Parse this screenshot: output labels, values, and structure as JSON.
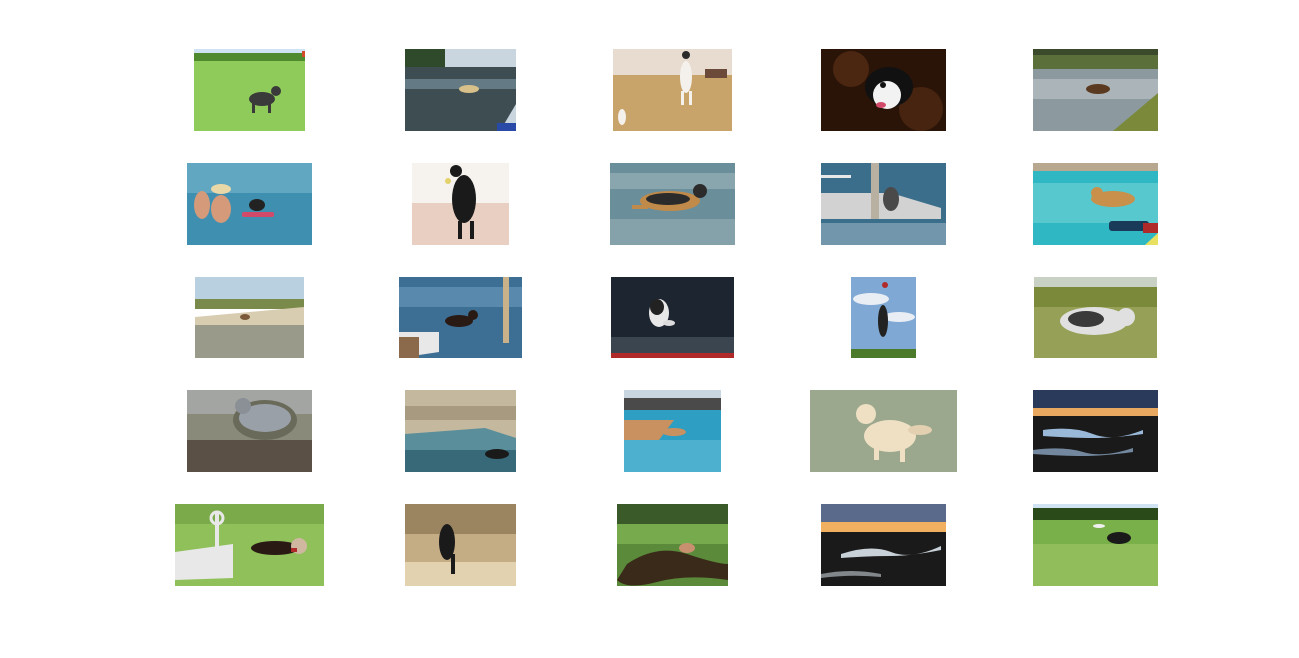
{
  "grid": {
    "rows": 5,
    "columns": 5
  },
  "thumbnails": [
    {
      "row": 1,
      "col": 1,
      "subject": "dog-running-on-grass",
      "palette": [
        "#8ecb5a",
        "#4f8a2e",
        "#3a3a3a",
        "#cfe3f2"
      ]
    },
    {
      "row": 1,
      "col": 2,
      "subject": "dog-swimming-near-dock",
      "palette": [
        "#3d4d52",
        "#7f9aa6",
        "#d8c08a",
        "#c9d6e0"
      ]
    },
    {
      "row": 1,
      "col": 3,
      "subject": "dogs-jumping-in-field",
      "palette": [
        "#c9a46a",
        "#e8dcd0",
        "#f4f1ec",
        "#6b4a3a"
      ]
    },
    {
      "row": 1,
      "col": 4,
      "subject": "dog-face-in-leaves",
      "palette": [
        "#2a1408",
        "#5a2e14",
        "#f2f2f2",
        "#111111"
      ]
    },
    {
      "row": 1,
      "col": 5,
      "subject": "dog-swimming-in-pond",
      "palette": [
        "#8c9aa0",
        "#5a6f3a",
        "#c9cfd2",
        "#5a3a20"
      ]
    },
    {
      "row": 2,
      "col": 1,
      "subject": "people-and-dog-in-sea",
      "palette": [
        "#3f8fb0",
        "#7ab8cf",
        "#d49a7a",
        "#d24a6a"
      ]
    },
    {
      "row": 2,
      "col": 2,
      "subject": "dog-catching-ball-silhouette",
      "palette": [
        "#f6f3ef",
        "#e8cfc2",
        "#1a1a1a",
        "#e3d26a"
      ]
    },
    {
      "row": 2,
      "col": 3,
      "subject": "shepherd-dog-leaping-in-water",
      "palette": [
        "#6a8e9a",
        "#9fb6bc",
        "#c08a4a",
        "#2b2b2b"
      ]
    },
    {
      "row": 2,
      "col": 4,
      "subject": "dog-jumping-off-pier",
      "palette": [
        "#3a6e8a",
        "#d2d2d2",
        "#4a4a4a",
        "#a9c0cf"
      ]
    },
    {
      "row": 2,
      "col": 5,
      "subject": "dog-diving-into-pool",
      "palette": [
        "#2fb8c4",
        "#7fd8d8",
        "#c8904a",
        "#b02a2a"
      ]
    },
    {
      "row": 3,
      "col": 1,
      "subject": "dog-on-sandbar",
      "palette": [
        "#b9d0e0",
        "#d8cdb0",
        "#7a8a4a",
        "#9a9a8a"
      ]
    },
    {
      "row": 3,
      "col": 2,
      "subject": "dog-leaping-from-boat",
      "palette": [
        "#3d6f95",
        "#6d9cbf",
        "#c9b28a",
        "#2a1a14"
      ]
    },
    {
      "row": 3,
      "col": 3,
      "subject": "dog-catching-frisbee-night",
      "palette": [
        "#1c2530",
        "#3a4550",
        "#e8e8e8",
        "#b02a2a"
      ]
    },
    {
      "row": 3,
      "col": 4,
      "subject": "dog-jumping-for-frisbee-sky",
      "palette": [
        "#7fa8d4",
        "#e9eef5",
        "#4a7a2a",
        "#222222"
      ]
    },
    {
      "row": 3,
      "col": 5,
      "subject": "bearded-collie-running",
      "palette": [
        "#7a8a3a",
        "#a9b16a",
        "#e0e0e0",
        "#3a3a3a"
      ]
    },
    {
      "row": 4,
      "col": 1,
      "subject": "grey-shaggy-dog",
      "palette": [
        "#8a8a7a",
        "#6a6a5a",
        "#b9c0c8",
        "#5a5045"
      ]
    },
    {
      "row": 4,
      "col": 2,
      "subject": "dog-at-rocky-pool",
      "palette": [
        "#c4b89e",
        "#5a8e9a",
        "#2a5a6a",
        "#1a1a1a"
      ]
    },
    {
      "row": 4,
      "col": 3,
      "subject": "dog-swimming-in-canal",
      "palette": [
        "#2e9fc2",
        "#6ac2da",
        "#c99060",
        "#4a4a4a"
      ]
    },
    {
      "row": 4,
      "col": 4,
      "subject": "golden-dog-in-frost-grass",
      "palette": [
        "#8a9a7a",
        "#b5beaa",
        "#efe0c4",
        "#7a6a55"
      ]
    },
    {
      "row": 4,
      "col": 5,
      "subject": "beach-at-dusk",
      "palette": [
        "#2a3a5a",
        "#e8a860",
        "#9ab8d8",
        "#1a1a1a"
      ]
    },
    {
      "row": 5,
      "col": 1,
      "subject": "dog-by-agility-obstacle",
      "palette": [
        "#8fc05a",
        "#e8e8e8",
        "#2a1a14",
        "#b02a2a"
      ]
    },
    {
      "row": 5,
      "col": 2,
      "subject": "dog-climbing-rocks",
      "palette": [
        "#c4ac85",
        "#8a7350",
        "#1a1a1a",
        "#e2d2b0"
      ]
    },
    {
      "row": 5,
      "col": 3,
      "subject": "dog-in-creek",
      "palette": [
        "#5a8a3a",
        "#8ac05a",
        "#3a2a1a",
        "#7a6a5a"
      ]
    },
    {
      "row": 5,
      "col": 4,
      "subject": "tidal-flat-at-sunset",
      "palette": [
        "#f0b060",
        "#5a6a8a",
        "#1a1a1a",
        "#c8d0d8"
      ]
    },
    {
      "row": 5,
      "col": 5,
      "subject": "dog-catching-frisbee-park",
      "palette": [
        "#7ab04a",
        "#a8cc6a",
        "#2a4a1a",
        "#f0f0f0"
      ]
    }
  ]
}
